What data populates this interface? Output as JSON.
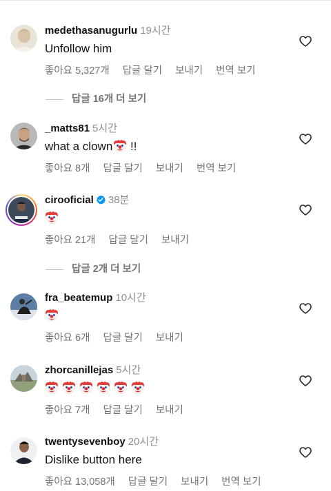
{
  "comments": [
    {
      "username": "medethasanugurlu",
      "time": "19시간",
      "text": "Unfollow him",
      "like_count": "좋아요 5,327개",
      "reply": "답글 달기",
      "send": "보내기",
      "translate": "번역 보기"
    },
    {
      "username": "_matts81",
      "time": "5시간",
      "text": "what a clown",
      "text_suffix": " !!",
      "like_count": "좋아요 8개",
      "reply": "답글 달기",
      "send": "보내기",
      "translate": "번역 보기"
    },
    {
      "username": "cirooficial",
      "time": "38분",
      "like_count": "좋아요 21개",
      "reply": "답글 달기",
      "send": "보내기"
    },
    {
      "username": "fra_beatemup",
      "time": "10시간",
      "like_count": "좋아요 6개",
      "reply": "답글 달기",
      "send": "보내기"
    },
    {
      "username": "zhorcanillejas",
      "time": "5시간",
      "like_count": "좋아요 7개",
      "reply": "답글 달기",
      "send": "보내기"
    },
    {
      "username": "twentysevenboy",
      "time": "20시간",
      "text": "Dislike button here",
      "like_count": "좋아요 13,058개",
      "reply": "답글 달기",
      "send": "보내기",
      "translate": "번역 보기"
    }
  ],
  "view_replies": [
    "답글 16개 더 보기",
    "답글 2개 더 보기"
  ],
  "colors": {
    "muted": "#737373",
    "verified": "#0095f6"
  },
  "icons": [
    "heart-outline-icon",
    "clown-face-emoji",
    "verified-badge-icon"
  ]
}
